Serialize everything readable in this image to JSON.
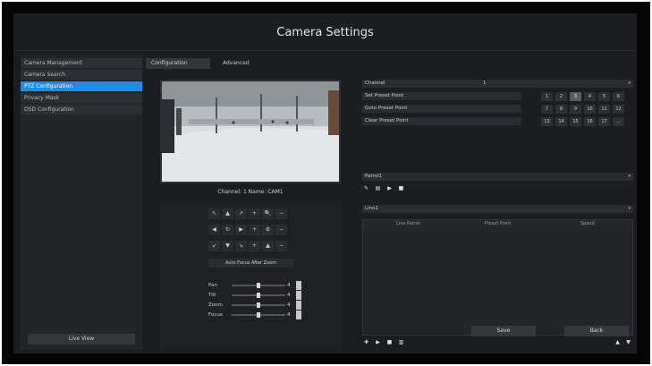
{
  "title": "Camera Settings",
  "sidebar": {
    "items": [
      {
        "label": "Camera Management",
        "active": false
      },
      {
        "label": "Camera Search",
        "active": false
      },
      {
        "label": "PTZ Configuration",
        "active": true
      },
      {
        "label": "Privacy Mask",
        "active": false
      },
      {
        "label": "OSD Configuration",
        "active": false
      }
    ],
    "live_view": "Live View"
  },
  "tabs": [
    {
      "label": "Configuration",
      "active": true
    },
    {
      "label": "Advanced",
      "active": false
    }
  ],
  "preview": {
    "caption": "Channel: 1 Name: CAM1"
  },
  "ptz": {
    "pad": [
      [
        "↖",
        "▲",
        "↗",
        "+",
        "🔍",
        "−"
      ],
      [
        "◀",
        "↻",
        "▶",
        "+",
        "⚙",
        "−"
      ],
      [
        "↙",
        "▼",
        "↘",
        "+",
        "▲",
        "−"
      ]
    ],
    "auto_focus": "Auto Focus After Zoom",
    "sliders": [
      {
        "label": "Pan",
        "value": "4"
      },
      {
        "label": "Tilt",
        "value": "4"
      },
      {
        "label": "Zoom",
        "value": "4"
      },
      {
        "label": "Focus",
        "value": "4"
      }
    ]
  },
  "right": {
    "channel_label": "Channel",
    "channel_value": "1",
    "preset_actions": [
      "Set Preset Point",
      "Goto Preset Point",
      "Clear Preset Point"
    ],
    "preset_numbers": [
      "1",
      "2",
      "3",
      "4",
      "5",
      "6",
      "7",
      "8",
      "9",
      "10",
      "11",
      "12",
      "13",
      "14",
      "15",
      "16",
      "17",
      "..."
    ],
    "active_preset": "3",
    "patrol_select": "Patrol1",
    "cruise_select": "Line1",
    "table_headers": [
      "Line Patrol",
      "Preset Point",
      "Speed"
    ]
  },
  "buttons": {
    "save": "Save",
    "back": "Back"
  },
  "colors": {
    "accent": "#1e8fe0",
    "background": "#1c1d20"
  }
}
